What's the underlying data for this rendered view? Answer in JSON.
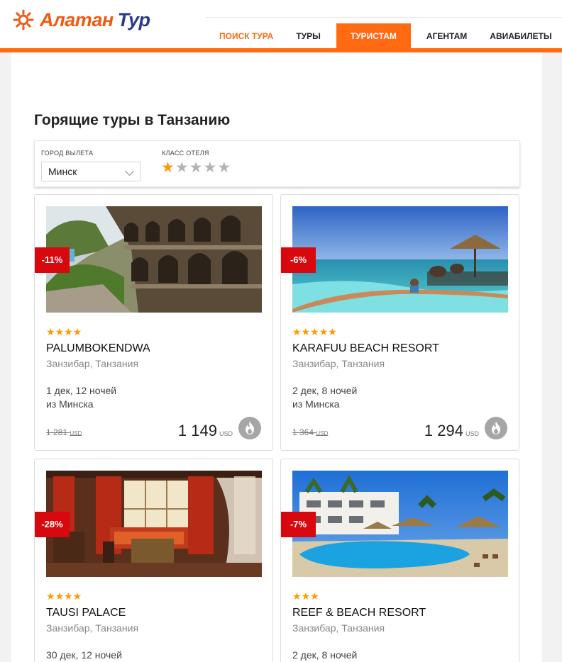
{
  "logo": {
    "part1": "Алатан",
    "part2": "Тур"
  },
  "nav": [
    {
      "label": "Поиск тура",
      "state": "orange"
    },
    {
      "label": "Туры",
      "state": ""
    },
    {
      "label": "Туристам",
      "state": "active"
    },
    {
      "label": "Агентам",
      "state": ""
    },
    {
      "label": "Авиабилеты",
      "state": ""
    }
  ],
  "page": {
    "title": "Горящие туры в Танзанию"
  },
  "filter": {
    "city_label": "Город вылета",
    "city_value": "Минск",
    "class_label": "Класс отеля",
    "selected_stars": 1,
    "max_stars": 5
  },
  "colors": {
    "brand_orange": "#ff6a13",
    "badge_red": "#d7080e",
    "star": "#ff9a00"
  },
  "cards": [
    {
      "discount": "-11%",
      "stars": 4,
      "name": "PALUMBOKENDWA",
      "location": "Занзибар, Танзания",
      "dates": "1 дек, 12 ночей",
      "from": "из Минска",
      "old_price": "1 281",
      "old_currency": "USD",
      "price": "1 149",
      "currency": "USD",
      "image": "stone-hotel-terraces",
      "icon": "fire-icon"
    },
    {
      "discount": "-6%",
      "stars": 5,
      "name": "KARAFUU BEACH RESORT",
      "location": "Занзибар, Танзания",
      "dates": "2 дек, 8 ночей",
      "from": "из Минска",
      "old_price": "1 364",
      "old_currency": "USD",
      "price": "1 294",
      "currency": "USD",
      "image": "beach-infinity-pool",
      "icon": "fire-icon"
    },
    {
      "discount": "-28%",
      "stars": 4,
      "name": "TAUSI PALACE",
      "location": "Занзибар, Танзания",
      "dates": "30 дек, 12 ночей",
      "from": "",
      "old_price": "",
      "old_currency": "",
      "price": "",
      "currency": "",
      "image": "palace-interior",
      "icon": "fire-icon"
    },
    {
      "discount": "-7%",
      "stars": 3,
      "name": "REEF & BEACH RESORT",
      "location": "Занзибар, Танзания",
      "dates": "2 дек, 8 ночей",
      "from": "",
      "old_price": "",
      "old_currency": "",
      "price": "",
      "currency": "",
      "image": "resort-pool",
      "icon": "fire-icon"
    }
  ]
}
